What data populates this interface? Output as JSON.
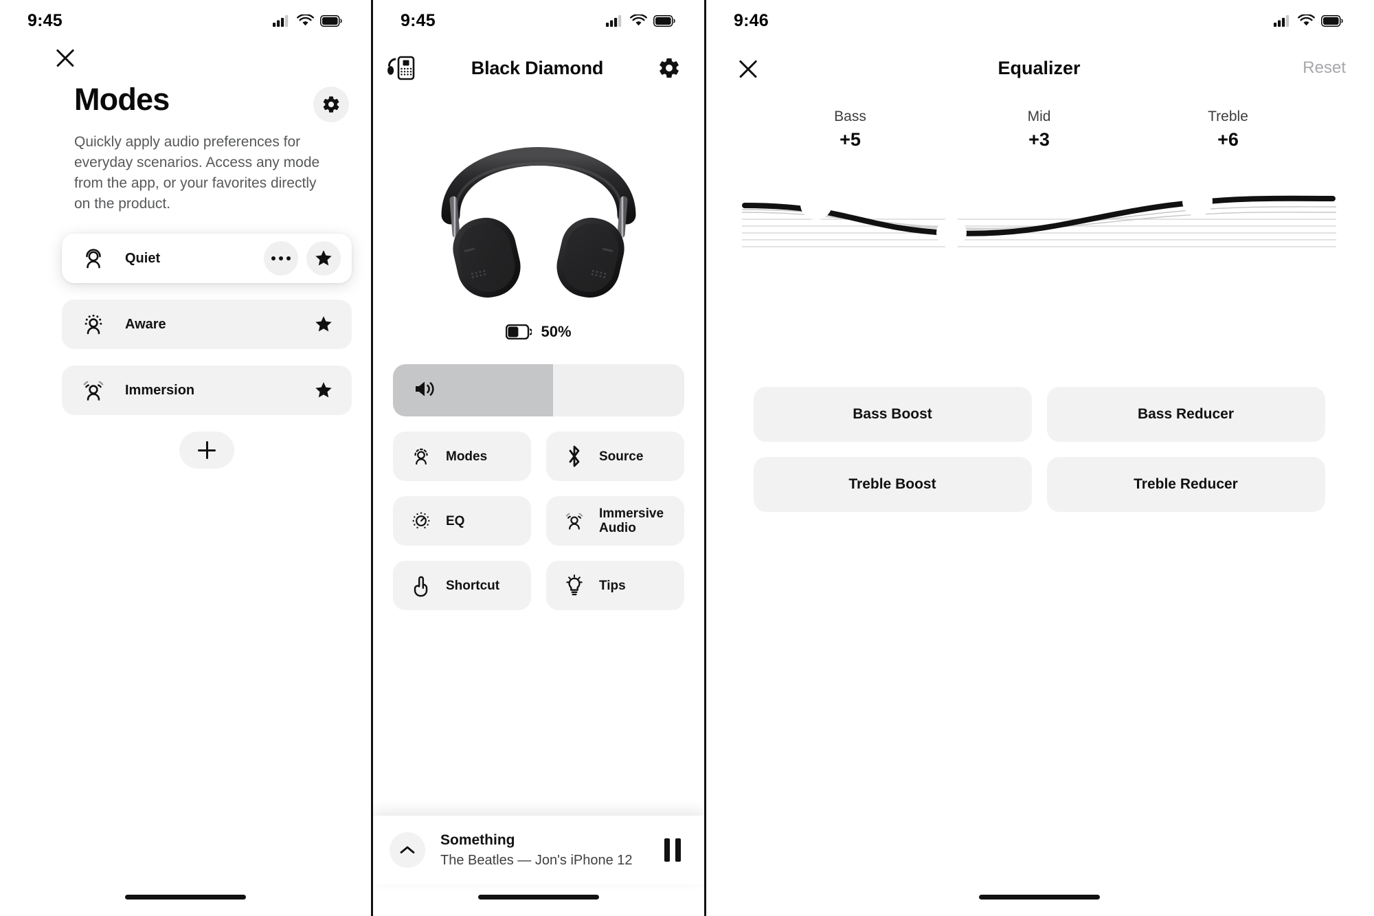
{
  "screens": {
    "modes": {
      "status": {
        "time": "9:45",
        "signal_icon": "cellular-bars-icon",
        "wifi_icon": "wifi-icon",
        "battery_icon": "battery-full-icon"
      },
      "close_label": "close-icon",
      "title": "Modes",
      "settings_icon": "gear-icon",
      "description": "Quickly apply audio preferences for everyday scenarios. Access any mode from the app, or your favorites directly on the product.",
      "items": [
        {
          "label": "Quiet",
          "icon": "quiet-mode-icon",
          "active": true,
          "has_more": true,
          "favorite": true
        },
        {
          "label": "Aware",
          "icon": "aware-mode-icon",
          "active": false,
          "has_more": false,
          "favorite": true
        },
        {
          "label": "Immersion",
          "icon": "immersion-mode-icon",
          "active": false,
          "has_more": false,
          "favorite": true
        }
      ],
      "add_button_label": "+"
    },
    "device": {
      "status": {
        "time": "9:45",
        "signal_icon": "cellular-bars-icon",
        "wifi_icon": "wifi-icon",
        "battery_icon": "battery-full-icon"
      },
      "header_left_icon": "headset-device-icon",
      "title": "Black Diamond",
      "settings_icon": "gear-icon",
      "product_image_alt": "black over-ear headphones",
      "battery": {
        "percent_label": "50%",
        "level": 50
      },
      "volume": {
        "icon": "speaker-volume-icon",
        "level": 55
      },
      "tiles": [
        {
          "label": "Modes",
          "icon": "modes-icon"
        },
        {
          "label": "Source",
          "icon": "bluetooth-icon"
        },
        {
          "label": "EQ",
          "icon": "eq-dial-icon"
        },
        {
          "label": "Immersive Audio",
          "icon": "immersive-audio-icon"
        },
        {
          "label": "Shortcut",
          "icon": "tap-gesture-icon"
        },
        {
          "label": "Tips",
          "icon": "lightbulb-icon"
        }
      ],
      "now_playing": {
        "expand_icon": "chevron-up-icon",
        "track": "Something",
        "subtitle": "The Beatles — Jon's iPhone 12",
        "transport_icon": "pause-icon"
      }
    },
    "equalizer": {
      "status": {
        "time": "9:46",
        "signal_icon": "cellular-bars-icon",
        "wifi_icon": "wifi-icon",
        "battery_icon": "battery-full-icon"
      },
      "close_label": "close-icon",
      "title": "Equalizer",
      "reset_label": "Reset",
      "bands": [
        {
          "name": "Bass",
          "value": "+5"
        },
        {
          "name": "Mid",
          "value": "+3"
        },
        {
          "name": "Treble",
          "value": "+6"
        }
      ],
      "presets": [
        {
          "label": "Bass Boost"
        },
        {
          "label": "Bass Reducer"
        },
        {
          "label": "Treble Boost"
        },
        {
          "label": "Treble Reducer"
        }
      ]
    }
  },
  "colors": {
    "accent": "#111111",
    "tile_bg": "#f2f2f2",
    "volume_fill": "#c5c6c8",
    "muted_text": "#57585a",
    "reset_text": "#a6a7a9"
  }
}
